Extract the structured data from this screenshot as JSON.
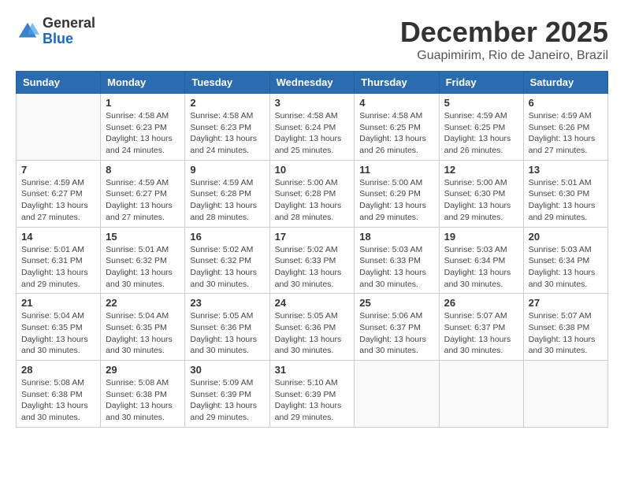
{
  "header": {
    "logo": {
      "general": "General",
      "blue": "Blue"
    },
    "title": "December 2025",
    "location": "Guapimirim, Rio de Janeiro, Brazil"
  },
  "weekdays": [
    "Sunday",
    "Monday",
    "Tuesday",
    "Wednesday",
    "Thursday",
    "Friday",
    "Saturday"
  ],
  "weeks": [
    [
      {
        "day": "",
        "info": ""
      },
      {
        "day": "1",
        "info": "Sunrise: 4:58 AM\nSunset: 6:23 PM\nDaylight: 13 hours\nand 24 minutes."
      },
      {
        "day": "2",
        "info": "Sunrise: 4:58 AM\nSunset: 6:23 PM\nDaylight: 13 hours\nand 24 minutes."
      },
      {
        "day": "3",
        "info": "Sunrise: 4:58 AM\nSunset: 6:24 PM\nDaylight: 13 hours\nand 25 minutes."
      },
      {
        "day": "4",
        "info": "Sunrise: 4:58 AM\nSunset: 6:25 PM\nDaylight: 13 hours\nand 26 minutes."
      },
      {
        "day": "5",
        "info": "Sunrise: 4:59 AM\nSunset: 6:25 PM\nDaylight: 13 hours\nand 26 minutes."
      },
      {
        "day": "6",
        "info": "Sunrise: 4:59 AM\nSunset: 6:26 PM\nDaylight: 13 hours\nand 27 minutes."
      }
    ],
    [
      {
        "day": "7",
        "info": "Sunrise: 4:59 AM\nSunset: 6:27 PM\nDaylight: 13 hours\nand 27 minutes."
      },
      {
        "day": "8",
        "info": "Sunrise: 4:59 AM\nSunset: 6:27 PM\nDaylight: 13 hours\nand 27 minutes."
      },
      {
        "day": "9",
        "info": "Sunrise: 4:59 AM\nSunset: 6:28 PM\nDaylight: 13 hours\nand 28 minutes."
      },
      {
        "day": "10",
        "info": "Sunrise: 5:00 AM\nSunset: 6:28 PM\nDaylight: 13 hours\nand 28 minutes."
      },
      {
        "day": "11",
        "info": "Sunrise: 5:00 AM\nSunset: 6:29 PM\nDaylight: 13 hours\nand 29 minutes."
      },
      {
        "day": "12",
        "info": "Sunrise: 5:00 AM\nSunset: 6:30 PM\nDaylight: 13 hours\nand 29 minutes."
      },
      {
        "day": "13",
        "info": "Sunrise: 5:01 AM\nSunset: 6:30 PM\nDaylight: 13 hours\nand 29 minutes."
      }
    ],
    [
      {
        "day": "14",
        "info": "Sunrise: 5:01 AM\nSunset: 6:31 PM\nDaylight: 13 hours\nand 29 minutes."
      },
      {
        "day": "15",
        "info": "Sunrise: 5:01 AM\nSunset: 6:32 PM\nDaylight: 13 hours\nand 30 minutes."
      },
      {
        "day": "16",
        "info": "Sunrise: 5:02 AM\nSunset: 6:32 PM\nDaylight: 13 hours\nand 30 minutes."
      },
      {
        "day": "17",
        "info": "Sunrise: 5:02 AM\nSunset: 6:33 PM\nDaylight: 13 hours\nand 30 minutes."
      },
      {
        "day": "18",
        "info": "Sunrise: 5:03 AM\nSunset: 6:33 PM\nDaylight: 13 hours\nand 30 minutes."
      },
      {
        "day": "19",
        "info": "Sunrise: 5:03 AM\nSunset: 6:34 PM\nDaylight: 13 hours\nand 30 minutes."
      },
      {
        "day": "20",
        "info": "Sunrise: 5:03 AM\nSunset: 6:34 PM\nDaylight: 13 hours\nand 30 minutes."
      }
    ],
    [
      {
        "day": "21",
        "info": "Sunrise: 5:04 AM\nSunset: 6:35 PM\nDaylight: 13 hours\nand 30 minutes."
      },
      {
        "day": "22",
        "info": "Sunrise: 5:04 AM\nSunset: 6:35 PM\nDaylight: 13 hours\nand 30 minutes."
      },
      {
        "day": "23",
        "info": "Sunrise: 5:05 AM\nSunset: 6:36 PM\nDaylight: 13 hours\nand 30 minutes."
      },
      {
        "day": "24",
        "info": "Sunrise: 5:05 AM\nSunset: 6:36 PM\nDaylight: 13 hours\nand 30 minutes."
      },
      {
        "day": "25",
        "info": "Sunrise: 5:06 AM\nSunset: 6:37 PM\nDaylight: 13 hours\nand 30 minutes."
      },
      {
        "day": "26",
        "info": "Sunrise: 5:07 AM\nSunset: 6:37 PM\nDaylight: 13 hours\nand 30 minutes."
      },
      {
        "day": "27",
        "info": "Sunrise: 5:07 AM\nSunset: 6:38 PM\nDaylight: 13 hours\nand 30 minutes."
      }
    ],
    [
      {
        "day": "28",
        "info": "Sunrise: 5:08 AM\nSunset: 6:38 PM\nDaylight: 13 hours\nand 30 minutes."
      },
      {
        "day": "29",
        "info": "Sunrise: 5:08 AM\nSunset: 6:38 PM\nDaylight: 13 hours\nand 30 minutes."
      },
      {
        "day": "30",
        "info": "Sunrise: 5:09 AM\nSunset: 6:39 PM\nDaylight: 13 hours\nand 29 minutes."
      },
      {
        "day": "31",
        "info": "Sunrise: 5:10 AM\nSunset: 6:39 PM\nDaylight: 13 hours\nand 29 minutes."
      },
      {
        "day": "",
        "info": ""
      },
      {
        "day": "",
        "info": ""
      },
      {
        "day": "",
        "info": ""
      }
    ]
  ]
}
